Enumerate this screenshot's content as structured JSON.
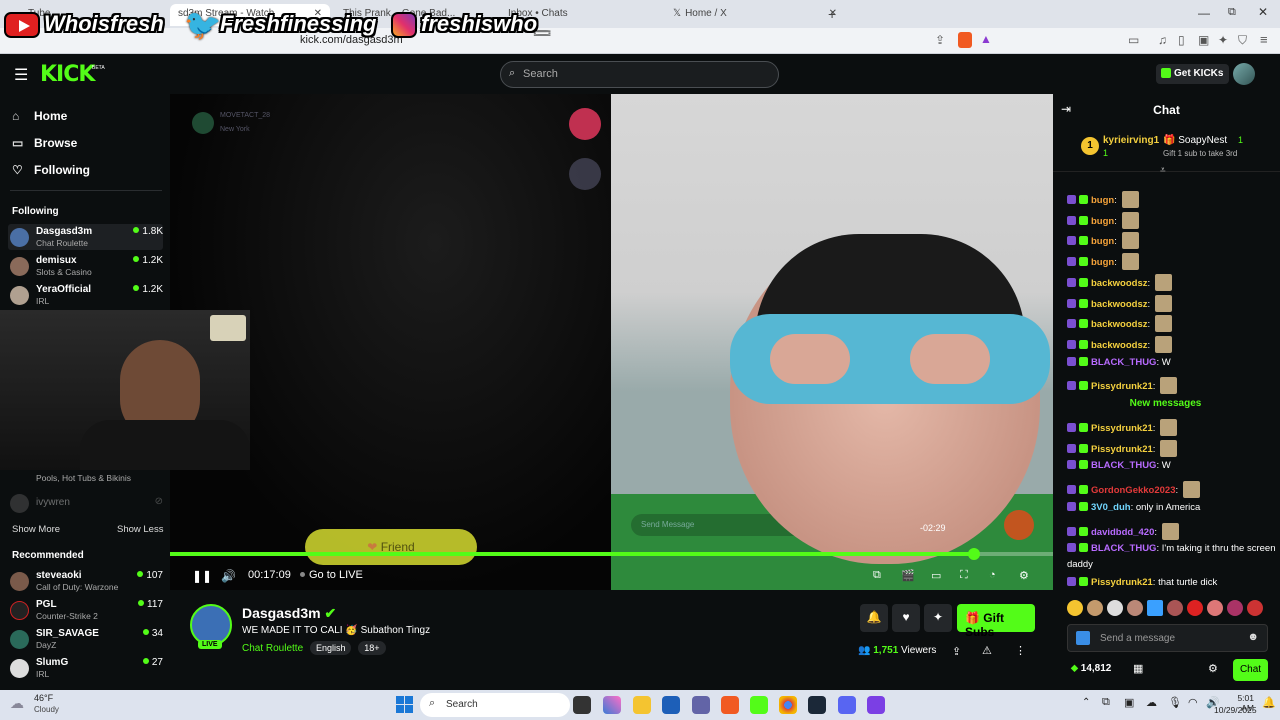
{
  "browser": {
    "tabs": [
      {
        "label": "Tube"
      },
      {
        "label": "sd3m Stream - Watch"
      },
      {
        "label": "This Prank... Gone Bad..."
      },
      {
        "label": "Inbox • Chats"
      },
      {
        "label": "Home / X"
      }
    ],
    "url": "kick.com/dasgasd3m"
  },
  "overlay": {
    "youtube": "Whoisfresh",
    "twitter": "Freshfinessing",
    "instagram": "freshiswho_"
  },
  "header": {
    "logo": "KICK",
    "logo_sup": "BETA",
    "search_placeholder": "Search",
    "get_kicks": "Get KICKs"
  },
  "sidebar": {
    "nav": [
      {
        "label": "Home",
        "icon": "home-icon"
      },
      {
        "label": "Browse",
        "icon": "browse-icon"
      },
      {
        "label": "Following",
        "icon": "heart-icon"
      }
    ],
    "following_heading": "Following",
    "following": [
      {
        "name": "Dasgasd3m",
        "category": "Chat Roulette",
        "viewers": "1.8K"
      },
      {
        "name": "demisux",
        "category": "Slots & Casino",
        "viewers": "1.2K"
      },
      {
        "name": "YeraOfficial",
        "category": "IRL",
        "viewers": "1.2K"
      }
    ],
    "partial_category": "Pools, Hot Tubs & Bikinis",
    "offline_name": "ivywren",
    "show_more": "Show More",
    "show_less": "Show Less",
    "recommended_heading": "Recommended",
    "recommended": [
      {
        "name": "steveaoki",
        "category": "Call of Duty: Warzone",
        "viewers": "107"
      },
      {
        "name": "PGL",
        "category": "Counter-Strike 2",
        "viewers": "117"
      },
      {
        "name": "SIR_SAVAGE",
        "category": "DayZ",
        "viewers": "34"
      },
      {
        "name": "SlumG",
        "category": "IRL",
        "viewers": "27"
      }
    ]
  },
  "video": {
    "overlay_user": "MOVETACT_28",
    "overlay_location": "New York",
    "friend_button": "Friend",
    "send_message_hint": "Send Message",
    "remaining": "-02:29",
    "elapsed": "00:17:09",
    "go_live": "Go to LIVE",
    "progress": 0.91
  },
  "stream": {
    "name": "Dasgasd3m",
    "title": "WE MADE IT TO CALI 🥳 Subathon Tingz",
    "category": "Chat Roulette",
    "tags": [
      "English",
      "18+"
    ],
    "live_label": "LIVE",
    "viewers": "1,751",
    "viewers_label": "Viewers",
    "gift_subs": "Gift Subs"
  },
  "chat": {
    "title": "Chat",
    "pinned": {
      "rank": "1",
      "user1": "kyrieirving1",
      "user1_count": "1",
      "user2": "SoapyNest",
      "user2_count": "1",
      "gift_text": "Gift 1 sub to take 3rd"
    },
    "messages": [
      {
        "user": "bugn",
        "text": "",
        "color": "#f4a23a"
      },
      {
        "user": "bugn",
        "text": "",
        "color": "#f4a23a"
      },
      {
        "user": "bugn",
        "text": "",
        "color": "#f4a23a"
      },
      {
        "user": "bugn",
        "text": "",
        "color": "#f4a23a"
      },
      {
        "user": "backwoodsz",
        "text": "",
        "color": "#f4d03f"
      },
      {
        "user": "backwoodsz",
        "text": "",
        "color": "#f4d03f"
      },
      {
        "user": "backwoodsz",
        "text": "",
        "color": "#f4d03f"
      },
      {
        "user": "backwoodsz",
        "text": "",
        "color": "#f4d03f"
      },
      {
        "user": "BLACK_THUG",
        "text": "W",
        "color": "#b86bff"
      },
      {
        "user": "Pissydrunk21",
        "text": "",
        "color": "#f4d03f"
      }
    ],
    "new_messages": "New messages",
    "messages2": [
      {
        "user": "Pissydrunk21",
        "text": "",
        "color": "#f4d03f"
      },
      {
        "user": "Pissydrunk21",
        "text": "",
        "color": "#f4d03f"
      },
      {
        "user": "BLACK_THUG",
        "text": "W",
        "color": "#b86bff"
      },
      {
        "user": "GordonGekko2023",
        "text": "",
        "color": "#e23a3a"
      },
      {
        "user": "3V0_duh",
        "text": "only in America",
        "color": "#72d7ff"
      },
      {
        "user": "davidbdd_420",
        "text": "",
        "color": "#b86bff"
      },
      {
        "user": "BLACK_THUG",
        "text": "I'm taking it thru the screen",
        "text2": "daddy",
        "color": "#b86bff"
      },
      {
        "user": "Pissydrunk21",
        "text": "that turtle dick",
        "color": "#f4d03f"
      }
    ],
    "input_placeholder": "Send a message",
    "points": "14,812",
    "chat_button": "Chat"
  },
  "taskbar": {
    "weather_temp": "46°F",
    "weather_desc": "Cloudy",
    "search": "Search",
    "time": "5:01 AM",
    "date": "10/29/2025"
  }
}
